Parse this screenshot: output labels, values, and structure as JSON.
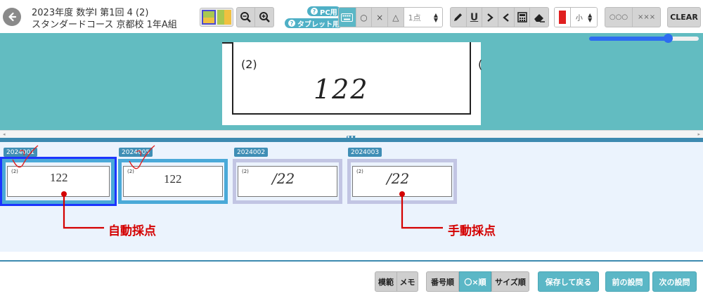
{
  "header": {
    "title_line1": "2023年度 数学Ⅰ 第1回 4 (2)",
    "title_line2": "スタンダードコース 京都校 1年A組"
  },
  "toolbar": {
    "pc_label": "PC用",
    "tablet_label": "タブレット用",
    "mark_circle": "○",
    "mark_cross": "×",
    "mark_triangle": "△",
    "points_value": "1点",
    "underline_label": "U",
    "size_value": "小",
    "marks_circles": "○○○",
    "marks_crosses": "×××",
    "clear_label": "CLEAR",
    "pen_color": "#e02020",
    "zoom_slider_percent": 72
  },
  "main": {
    "question_label": "(2)",
    "answer_text": "122"
  },
  "thumbnails": [
    {
      "id": "2024001",
      "question_label": "(2)",
      "answer": "122",
      "style": "typed",
      "state": "selected",
      "check_mark": true
    },
    {
      "id": "2024005",
      "question_label": "(2)",
      "answer": "122",
      "style": "typed",
      "state": "auto",
      "check_mark": true
    },
    {
      "id": "2024002",
      "question_label": "(2)",
      "answer": "/22",
      "style": "handwritten",
      "state": "manual",
      "check_mark": false
    },
    {
      "id": "2024003",
      "question_label": "(2)",
      "answer": "/22",
      "style": "handwritten",
      "state": "manual",
      "check_mark": false
    }
  ],
  "annotations": {
    "auto_label": "自動採点",
    "manual_label": "手動採点"
  },
  "footer": {
    "model_answer": "模範",
    "memo": "メモ",
    "sort_number": "番号順",
    "sort_mark": "〇×順",
    "sort_size": "サイズ順",
    "save_back": "保存して戻る",
    "prev_question": "前の設問",
    "next_question": "次の設問"
  },
  "colors": {
    "accent_teal": "#62bcc1",
    "tag_blue": "#3f8eb5",
    "selected_border": "#1c35ff",
    "auto_border": "#4aa9d8",
    "manual_border": "#b9bcdf",
    "annotation_red": "#d40000"
  }
}
